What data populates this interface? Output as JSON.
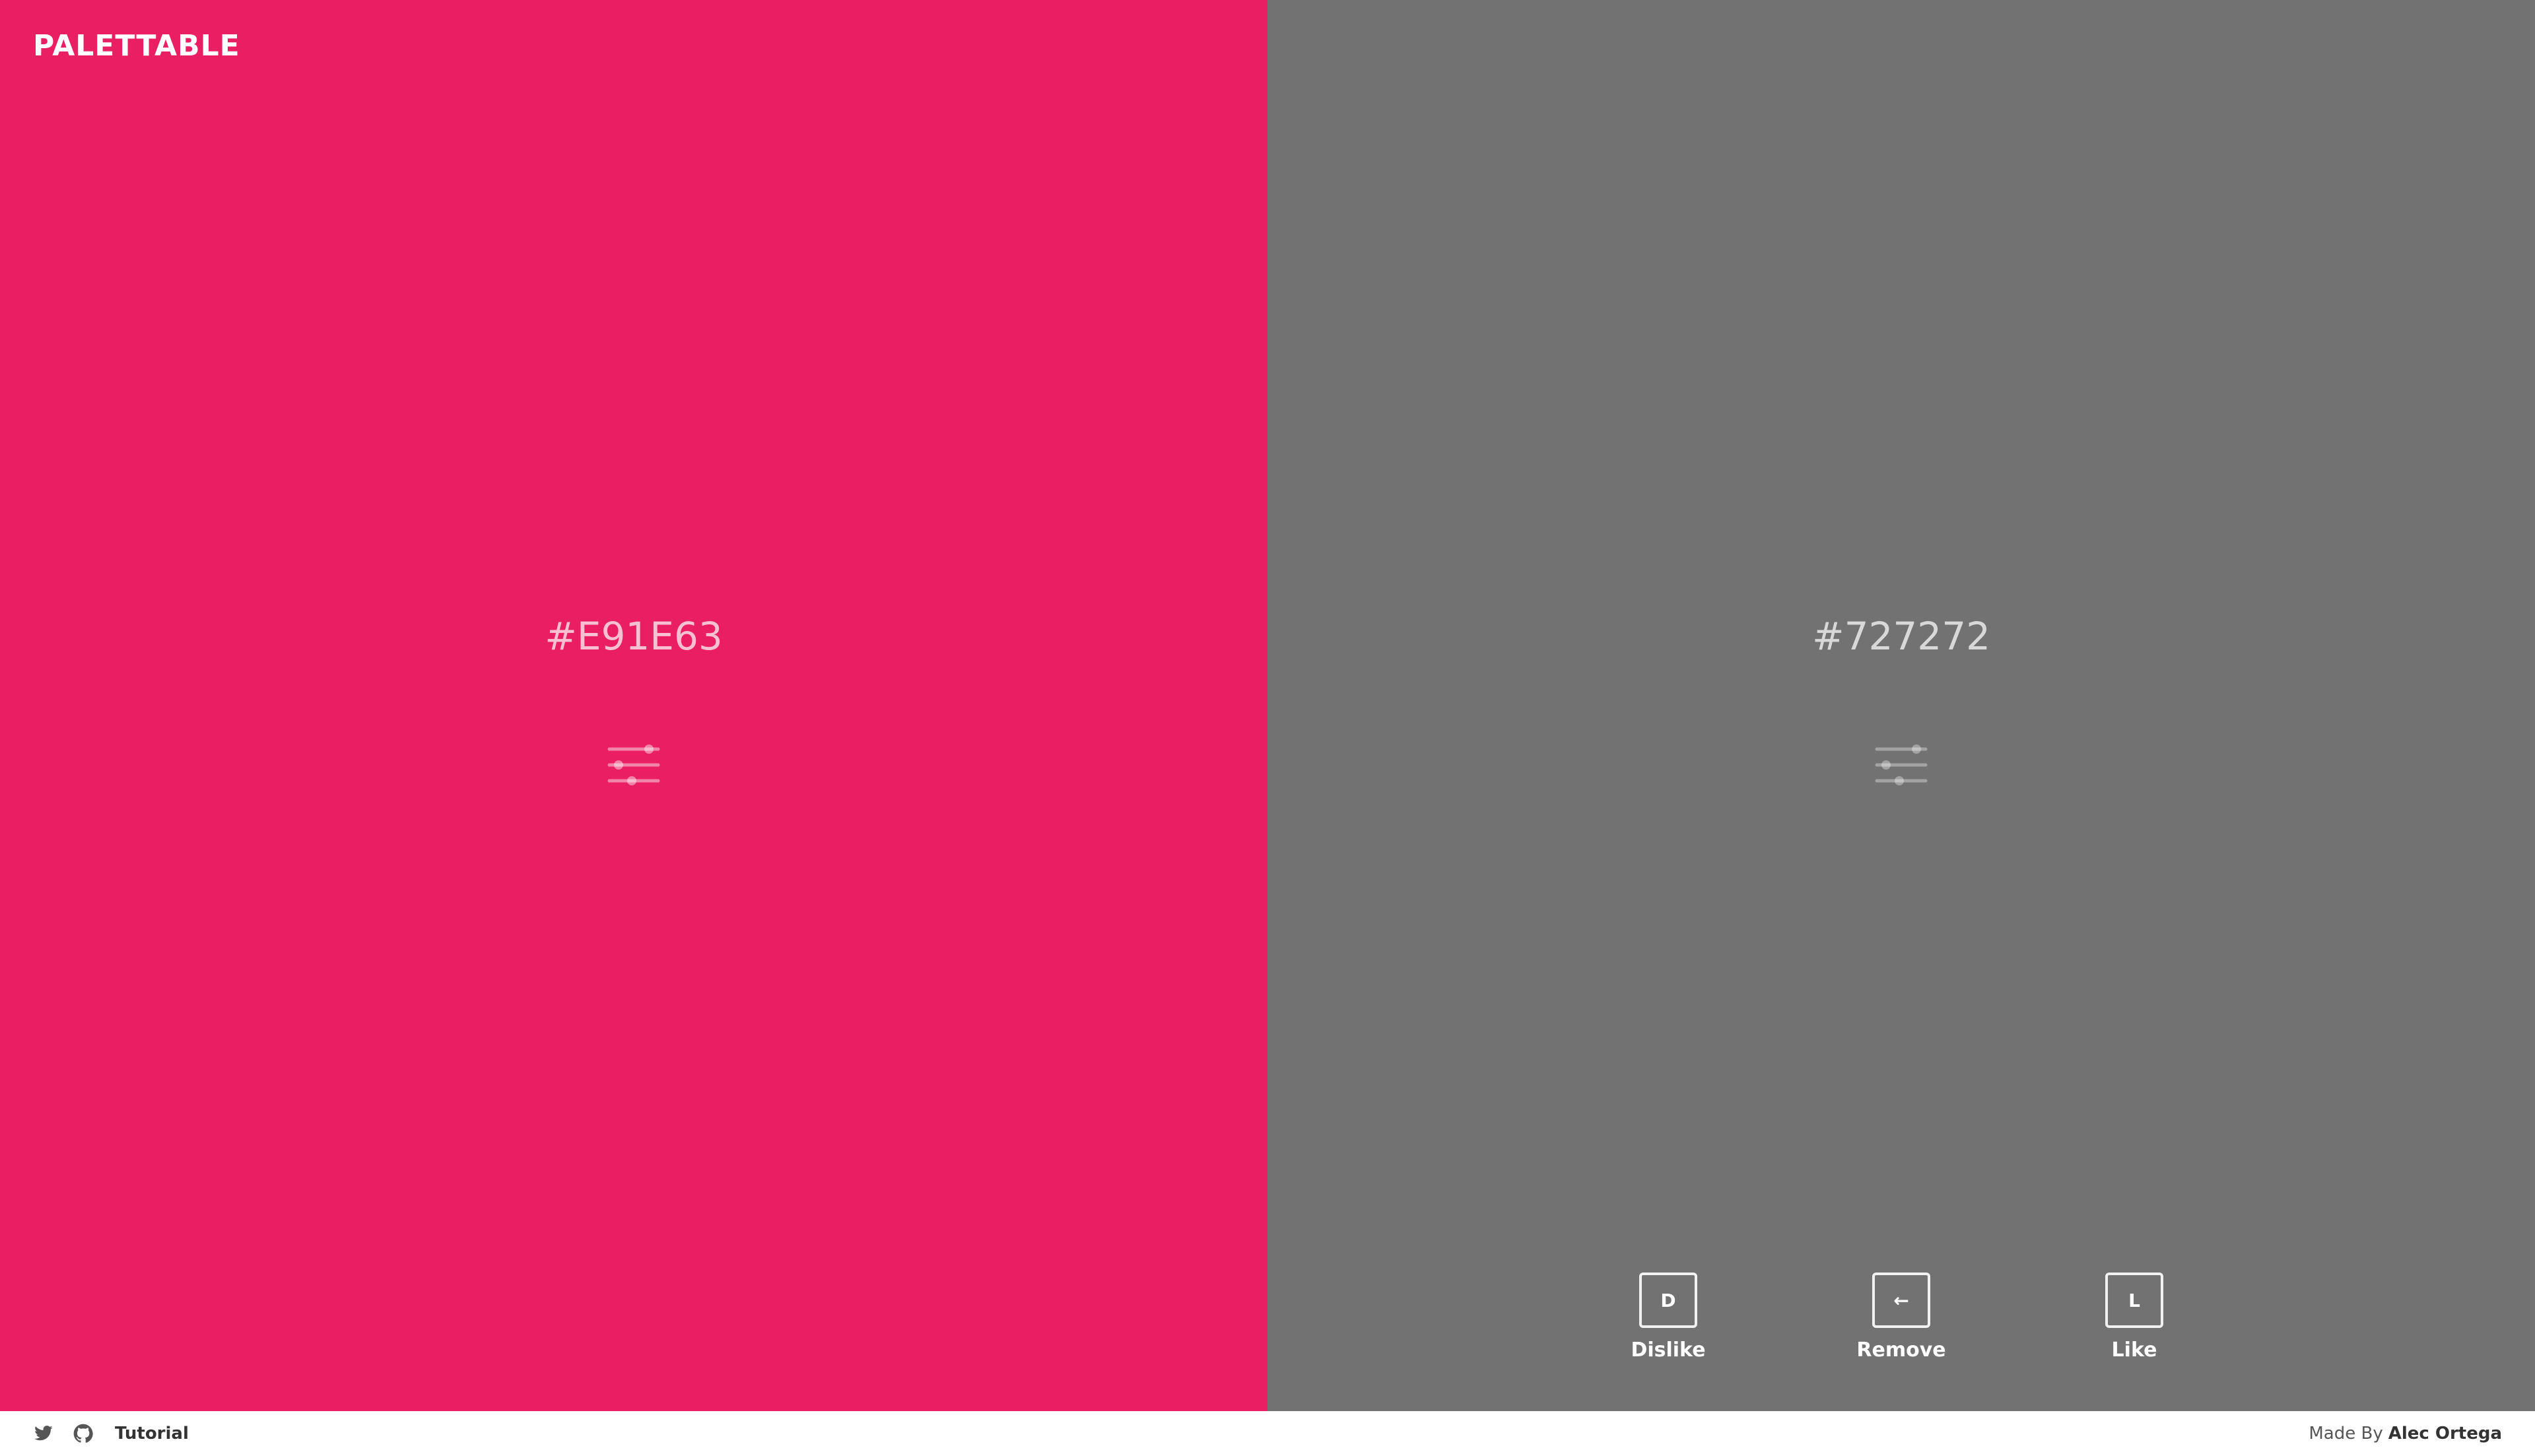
{
  "app": {
    "brand": "PALETTABLE"
  },
  "palette": {
    "colors": [
      {
        "hex": "#E91E63",
        "adjust_icon": "sliders-icon"
      },
      {
        "hex": "#727272",
        "adjust_icon": "sliders-icon"
      }
    ]
  },
  "actions": {
    "dislike": {
      "key": "D",
      "label": "Dislike"
    },
    "remove": {
      "key": "←",
      "label": "Remove"
    },
    "like": {
      "key": "L",
      "label": "Like"
    }
  },
  "footer": {
    "icons": [
      "twitter-icon",
      "github-icon"
    ],
    "tutorial_label": "Tutorial",
    "made_by_prefix": "Made By",
    "author": "Alec Ortega"
  },
  "colors": {
    "primary_swatch": "#E91E63",
    "secondary_swatch": "#727272",
    "footer_background": "#FFFFFF",
    "footer_text": "#333333"
  }
}
